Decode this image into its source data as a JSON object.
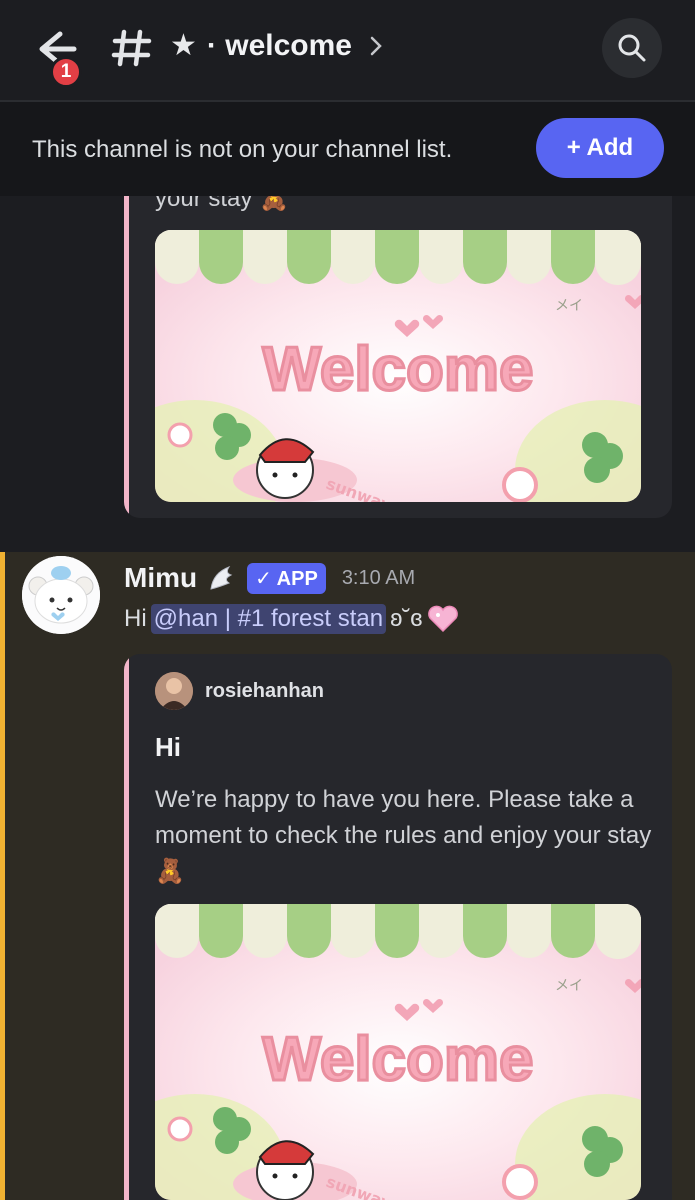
{
  "header": {
    "back_badge": "1",
    "channel_title": "· welcome"
  },
  "banner": {
    "text": "This channel is not on your channel list.",
    "add_label": "+ Add"
  },
  "upper_embed": {
    "partial_text": "your stay"
  },
  "message": {
    "author": "Mimu",
    "app_tag": "✓ APP",
    "time": "3:10 AM",
    "greeting": "Hi",
    "mention": "@han | #1 forest stan",
    "trailing_emote": "ʚ˘ɞ",
    "embed": {
      "author": "rosiehanhan",
      "title": "Hi",
      "description": "We’re happy to have you here. Please take a moment to check the rules and enjoy your stay"
    }
  },
  "welcome_image": {
    "text": "Welcome",
    "signature": "メイ",
    "tag": "sunway"
  },
  "colors": {
    "accent": "#5865f2",
    "highlight_border": "#f0b232",
    "embed_bar": "#f2b5c9",
    "badge": "#e23f45"
  }
}
